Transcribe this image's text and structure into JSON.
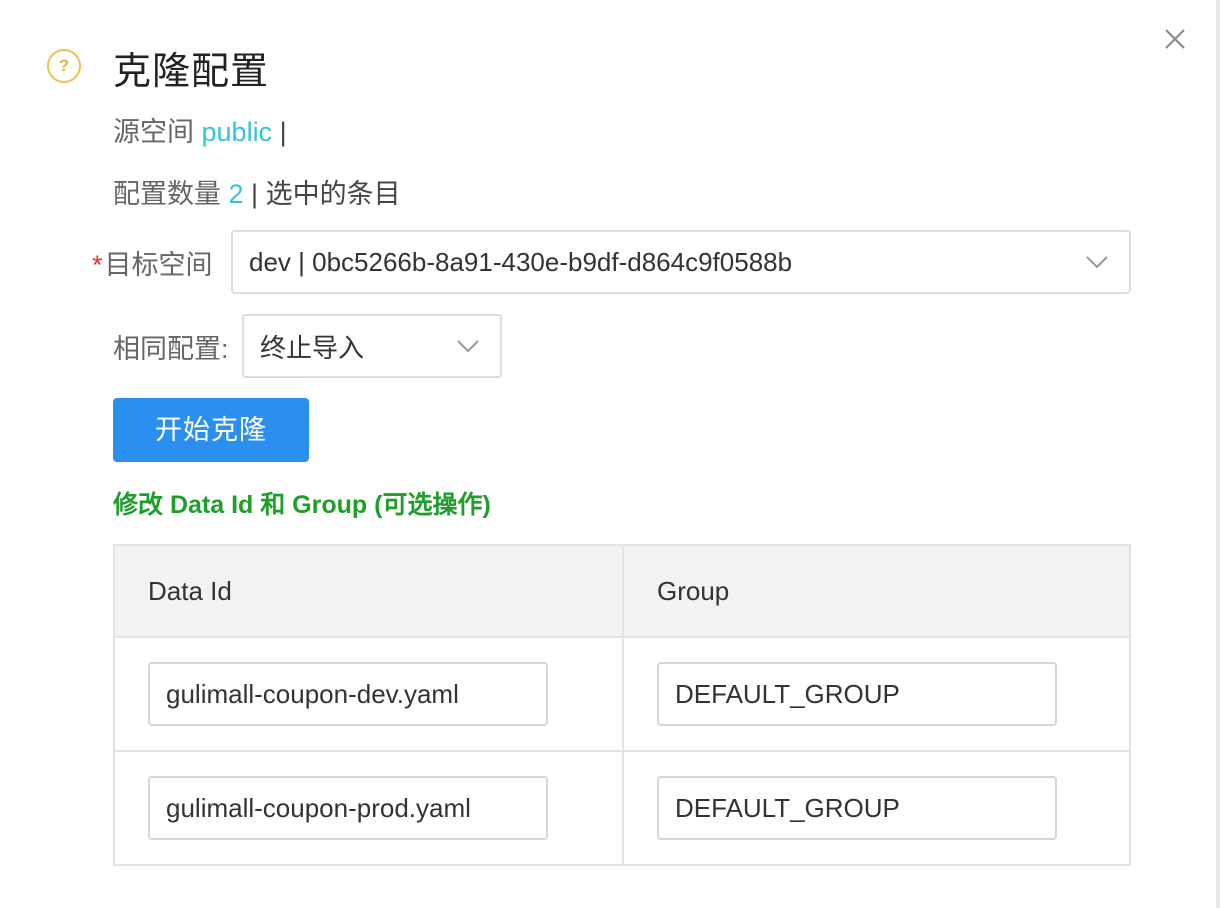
{
  "dialog": {
    "title": "克隆配置",
    "help_icon_glyph": "?",
    "source_label": "源空间",
    "source_value": "public",
    "source_sep": " |",
    "count_label": "配置数量",
    "count_value": "2",
    "count_suffix": " | 选中的条目",
    "target_label": "目标空间",
    "required_mark": "*",
    "target_value": "dev | 0bc5266b-8a91-430e-b9df-d864c9f0588b",
    "same_label": "相同配置:",
    "same_value": "终止导入",
    "start_button": "开始克隆",
    "modify_heading": "修改 Data Id 和 Group (可选操作)"
  },
  "table": {
    "headers": [
      "Data Id",
      "Group"
    ],
    "rows": [
      {
        "data_id": "gulimall-coupon-dev.yaml",
        "group": "DEFAULT_GROUP"
      },
      {
        "data_id": "gulimall-coupon-prod.yaml",
        "group": "DEFAULT_GROUP"
      }
    ]
  },
  "icons": {
    "close": "close-icon",
    "help": "question-circle-icon",
    "dropdown": "chevron-down-icon"
  },
  "colors": {
    "accent_link": "#35c3d9",
    "primary_button": "#2b8ff0",
    "heading_green": "#1f9e2a",
    "required": "#e8352d",
    "help_icon": "#f0c04a"
  }
}
